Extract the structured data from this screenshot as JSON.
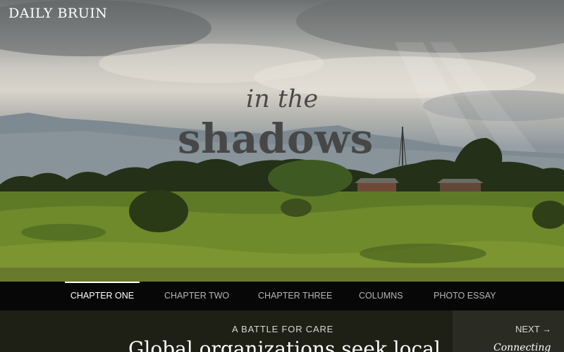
{
  "brand": {
    "name": "DAILY BRUIN"
  },
  "hero": {
    "title_small": "in the",
    "title_big": "shadows"
  },
  "nav": {
    "items": [
      {
        "label": "CHAPTER ONE",
        "active": true
      },
      {
        "label": "CHAPTER TWO",
        "active": false
      },
      {
        "label": "CHAPTER THREE",
        "active": false
      },
      {
        "label": "COLUMNS",
        "active": false
      },
      {
        "label": "PHOTO ESSAY",
        "active": false
      }
    ]
  },
  "article": {
    "kicker": "A BATTLE FOR CARE",
    "headline": "Global organizations seek local"
  },
  "next": {
    "label": "NEXT →",
    "title": "Connecting"
  },
  "colors": {
    "nav_bg": "#070707",
    "content_bg": "#1e1f15",
    "side_bg": "#2a2b22"
  }
}
